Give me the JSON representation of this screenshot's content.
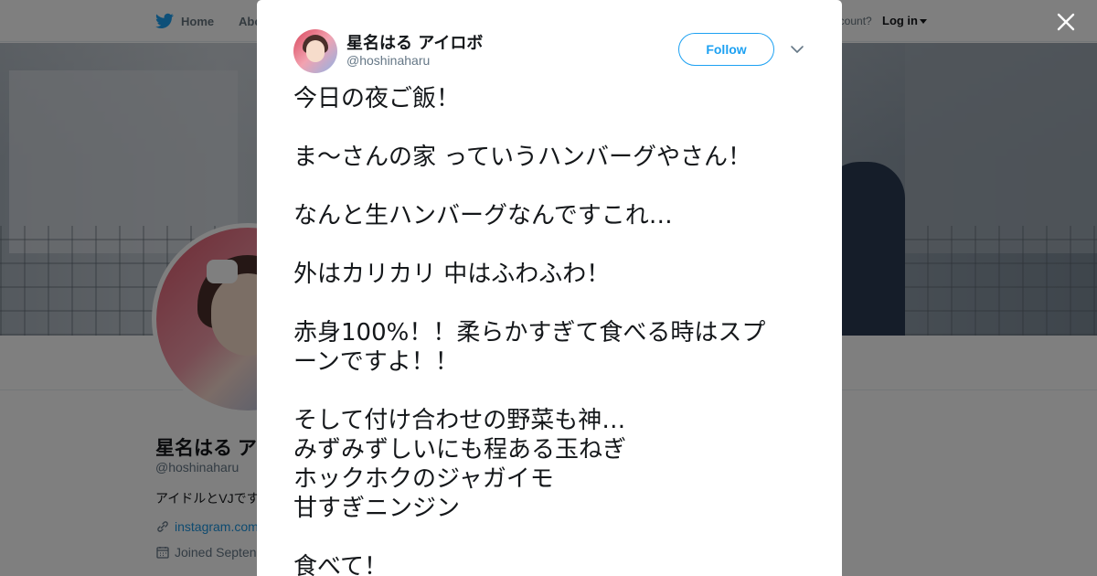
{
  "topnav": {
    "home_label": "Home",
    "about_label": "Abo",
    "account_text": "account?",
    "login_label": "Log in"
  },
  "profile": {
    "name": "星名はる ア",
    "handle": "@hoshinaharu",
    "bio": "アイドルとVJです",
    "link_text": "instagram.com",
    "joined_text": "Joined Septen"
  },
  "tweet": {
    "author_name": "星名はる アイロボ",
    "author_handle": "@hoshinaharu",
    "follow_label": "Follow",
    "lines": [
      "今日の夜ご飯！",
      "",
      "ま〜さんの家 っていうハンバーグやさん！",
      "",
      "なんと生ハンバーグなんですこれ…",
      "",
      "外はカリカリ 中はふわふわ！",
      "",
      "赤身100%！！柔らかすぎて食べる時はスプ",
      "ーンですよ！！",
      "",
      "そして付け合わせの野菜も神…",
      "みずみずしいにも程ある玉ねぎ",
      "ホックホクのジャガイモ",
      "甘すぎニンジン",
      "",
      "食べて！"
    ]
  },
  "colors": {
    "twitter_blue": "#1da1f2",
    "overlay": "rgba(0,0,0,0.5)",
    "text_primary": "#14171a",
    "text_secondary": "#657786"
  },
  "icons": {
    "nav_logo": "twitter-bird-icon",
    "close": "close-icon",
    "more": "chevron-down-icon",
    "link": "link-icon",
    "calendar": "calendar-icon"
  }
}
